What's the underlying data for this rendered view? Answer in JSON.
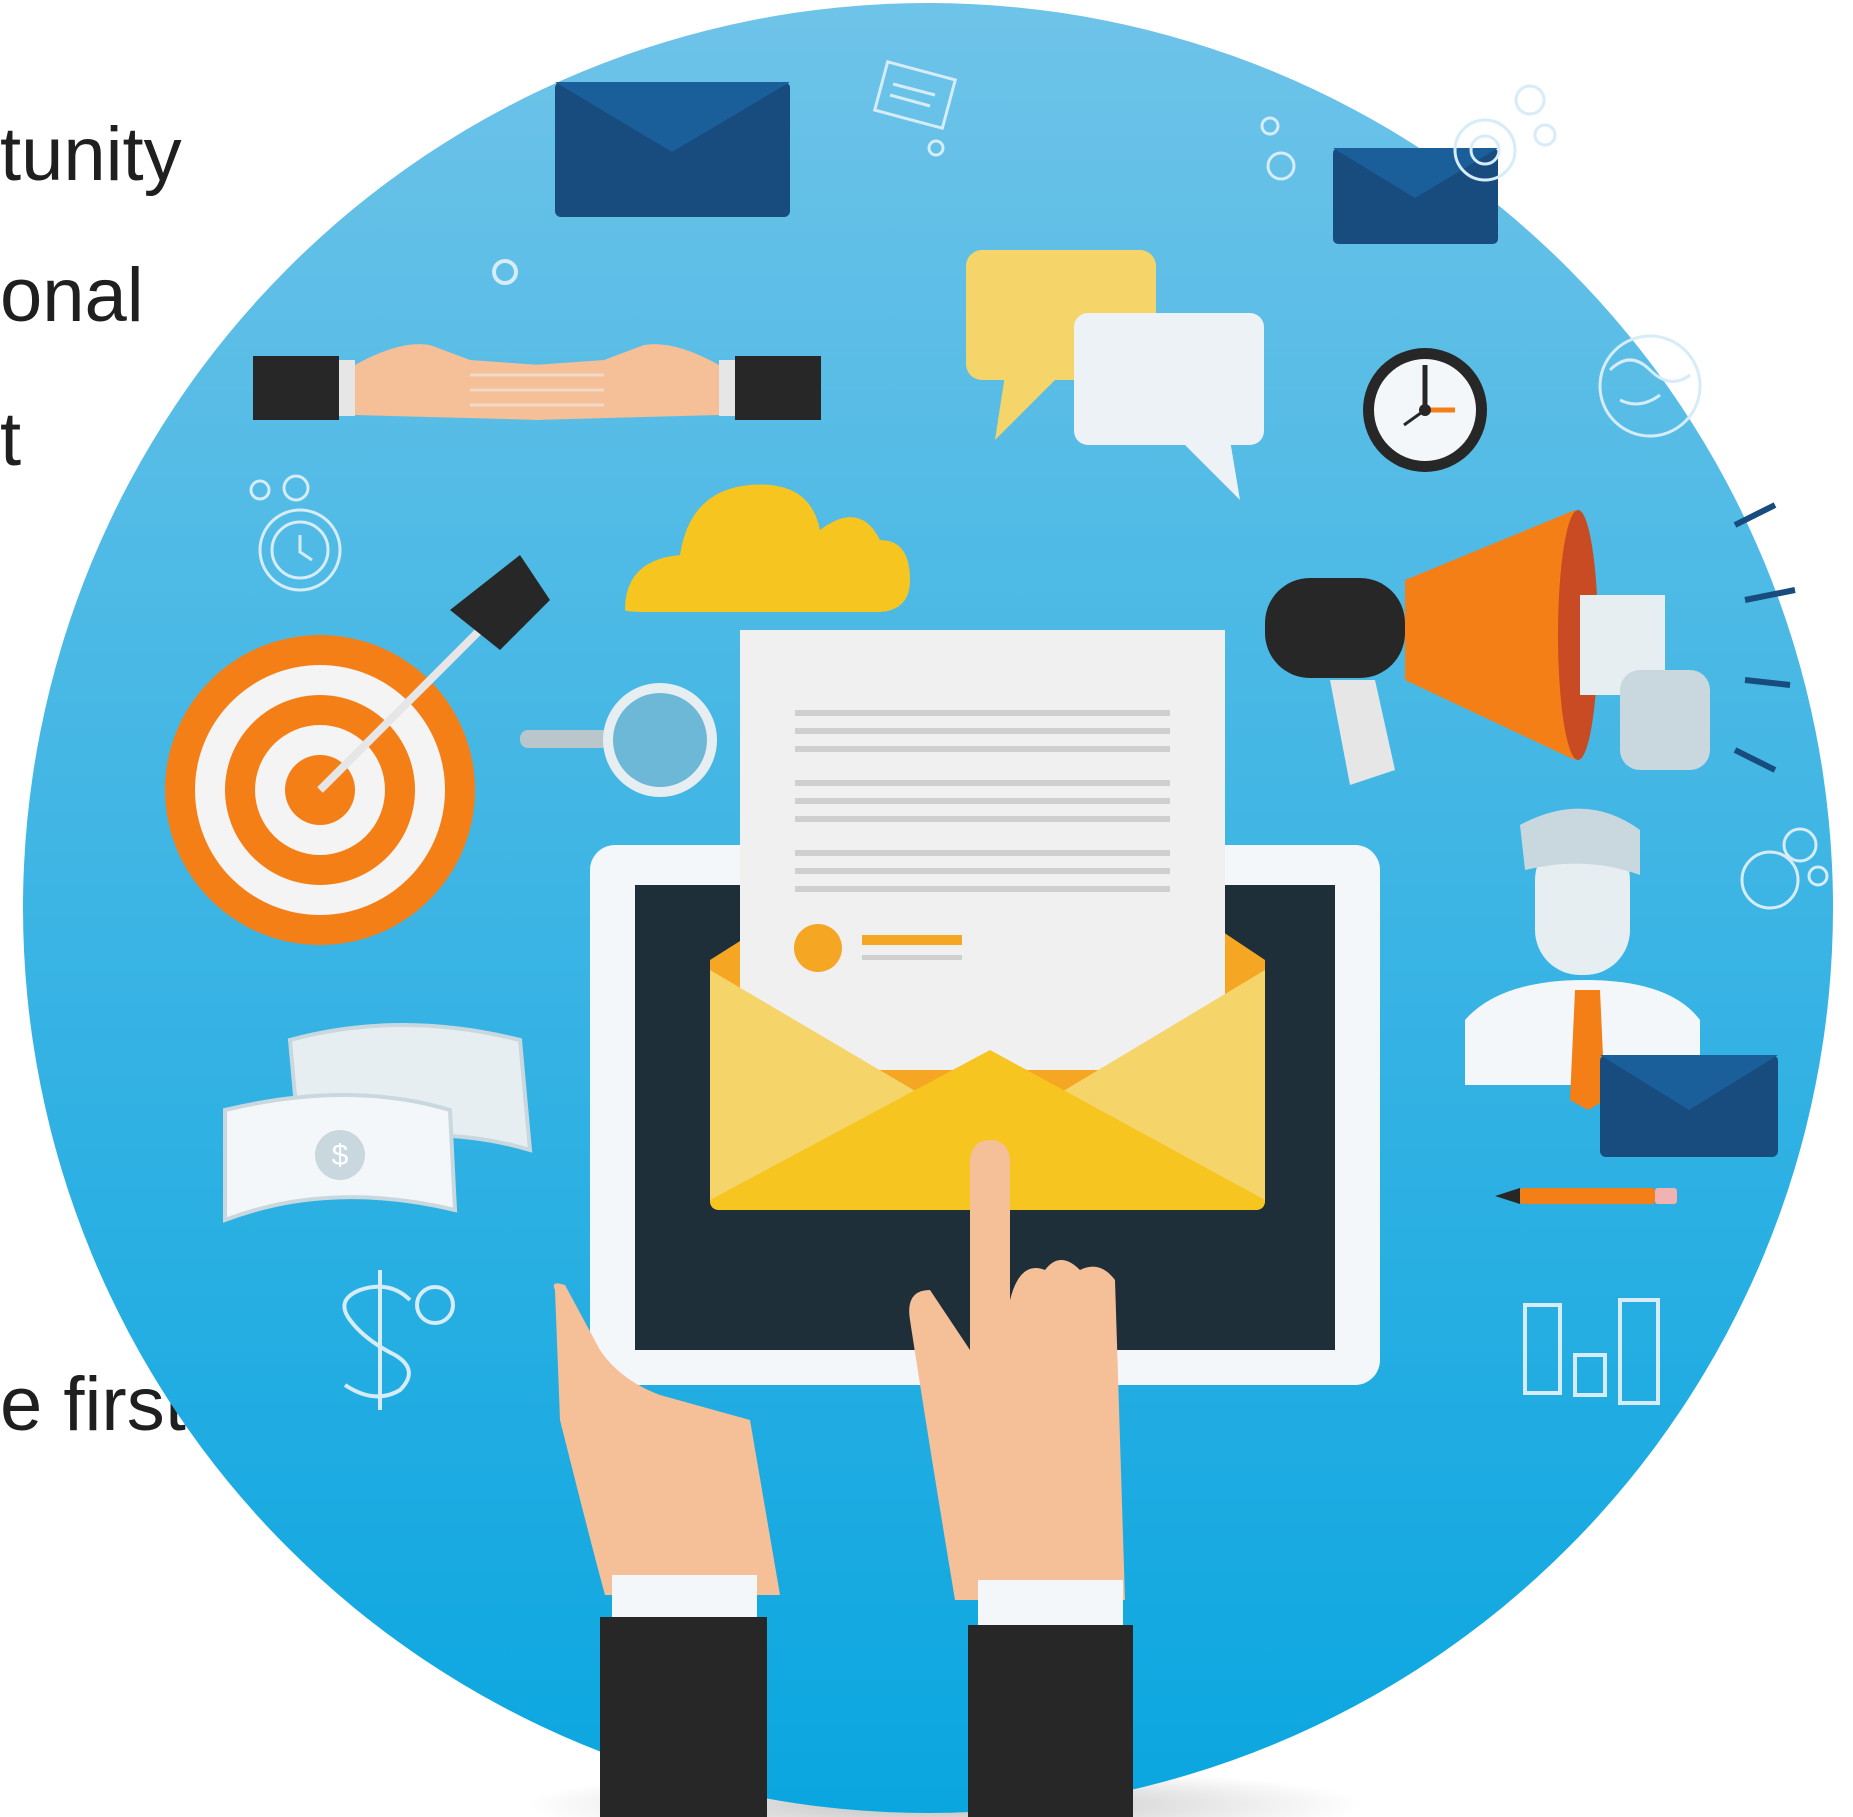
{
  "text_fragments": [
    "tunity",
    "onal",
    "t",
    "e first"
  ],
  "illustration": {
    "background_gradient": [
      "#6ec3e8",
      "#0aa6e0"
    ],
    "accent_colors": {
      "yellow": "#f7c51f",
      "orange": "#f57f17",
      "navy": "#184c7e",
      "dark": "#1f2f39",
      "skin": "#f5bf98",
      "paper": "#f0f0f0"
    },
    "icons": [
      "email-envelope-icon",
      "tablet-icon",
      "hand-pointer-icon",
      "target-icon",
      "megaphone-icon",
      "clock-icon",
      "handshake-icon",
      "chat-bubble-icon",
      "cloud-icon",
      "money-icon",
      "person-icon",
      "gear-icon",
      "globe-icon",
      "magnifier-icon",
      "pencil-icon",
      "bar-chart-icon",
      "dollar-icon",
      "newspaper-icon",
      "stopwatch-icon"
    ]
  }
}
